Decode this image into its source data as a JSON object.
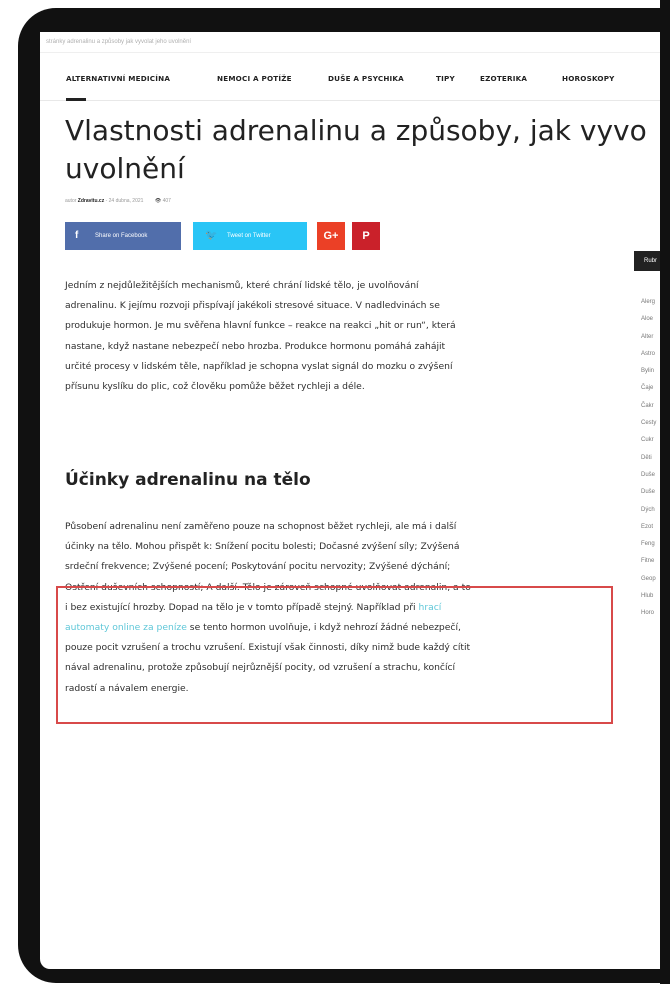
{
  "browser": {
    "url_text": "stránky adrenalinu a způsoby jak vyvolat jeho uvolnění"
  },
  "nav": {
    "items": [
      "ALTERNATIVNÍ MEDICÍNA",
      "NEMOCI A POTÍŽE",
      "DUŠE A PSYCHIKA",
      "TIPY",
      "EZOTERIKA",
      "HOROSKOPY"
    ]
  },
  "article": {
    "title_line1": "Vlastnosti adrenalinu a způsoby, jak vyvo",
    "title_line2": "uvolnění",
    "meta": {
      "author_prefix": "autor",
      "author": "Zdravitu.cz",
      "date": "24 dubna, 2021",
      "views": "407"
    },
    "share": {
      "facebook": "Share on Facebook",
      "twitter": "Tweet on Twitter",
      "gplus": "G+",
      "pinterest": "P"
    },
    "paragraph1": [
      "Jedním z nejdůležitějších mechanismů, které chrání lidské tělo, je uvolňování",
      "adrenalinu. K jejímu rozvoji přispívají jakékoli stresové situace. V nadledvinách se",
      "produkuje hormon. Je mu svěřena hlavní funkce – reakce na reakci „hit or run“, která",
      "nastane, když nastane nebezpečí nebo hrozba. Produkce hormonu pomáhá zahájit",
      "určité procesy v lidském těle, například je schopna vyslat signál do mozku o zvýšení",
      "přísunu kyslíku do plic, což člověku pomůže běžet rychleji a déle."
    ],
    "heading2": "Účinky adrenalinu na tělo",
    "paragraph2": {
      "line1": "Působení adrenalinu není zaměřeno pouze na schopnost běžet rychleji, ale má i další",
      "line2": "účinky na tělo. Mohou přispět k: Snížení pocitu bolesti; Dočasné zvýšení síly; Zvýšená",
      "line3": "srdeční frekvence; Zvýšené pocení; Poskytování pocitu nervozity; Zvýšené dýchání;",
      "line4": "Ostření duševních schopností; A další. Tělo je zároveň schopné uvolňovat adrenalin, a to",
      "line5": "i bez existující hrozby. Dopad na tělo je v tomto případě stejný. Například při",
      "link_a": "hrací",
      "link_b": "automaty online za peníze",
      "line6_rest": "se tento hormon uvolňuje, i když nehrozí žádné nebezpečí,",
      "line7": "pouze pocit vzrušení a trochu vzrušení. Existují však činnosti, díky nimž bude každý cítit",
      "line8": "nával adrenalinu, protože způsobují nejrůznější pocity, od vzrušení a strachu, končící",
      "line9": "radostí a návalem energie."
    }
  },
  "sidebar": {
    "heading": "Rubr",
    "items": [
      "Alerg",
      "Aloe",
      "Alter",
      "Astro",
      "Bylin",
      "Čaje",
      "Čakr",
      "Cesty",
      "Cukr",
      "Děti",
      "Duše",
      "Duše",
      "Dých",
      "Ezot",
      "Feng",
      "Fitne",
      "Geop",
      "Hlub",
      "Horo"
    ]
  },
  "colors": {
    "facebook": "#516eab",
    "twitter": "#29c5f6",
    "gplus": "#eb4026",
    "pinterest": "#ca212a",
    "highlight_border": "#d84a4a",
    "link": "#5fc7d8"
  }
}
